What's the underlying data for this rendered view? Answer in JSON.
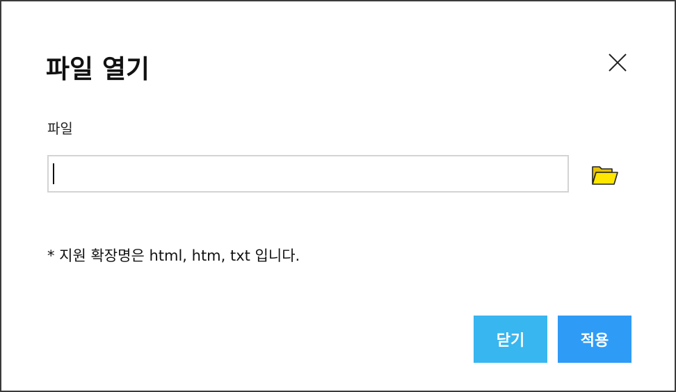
{
  "dialog": {
    "title": "파일 열기",
    "file_label": "파일",
    "file_input": {
      "value": "",
      "placeholder": ""
    },
    "hint": "* 지원 확장명은 html, htm, txt 입니다.",
    "buttons": {
      "close_label": "닫기",
      "apply_label": "적용"
    },
    "icons": {
      "close": "close-icon",
      "browse": "folder-open-icon"
    },
    "colors": {
      "close_button": "#38b6f0",
      "apply_button": "#2e9bf7",
      "folder_icon": "#ffe600"
    }
  }
}
